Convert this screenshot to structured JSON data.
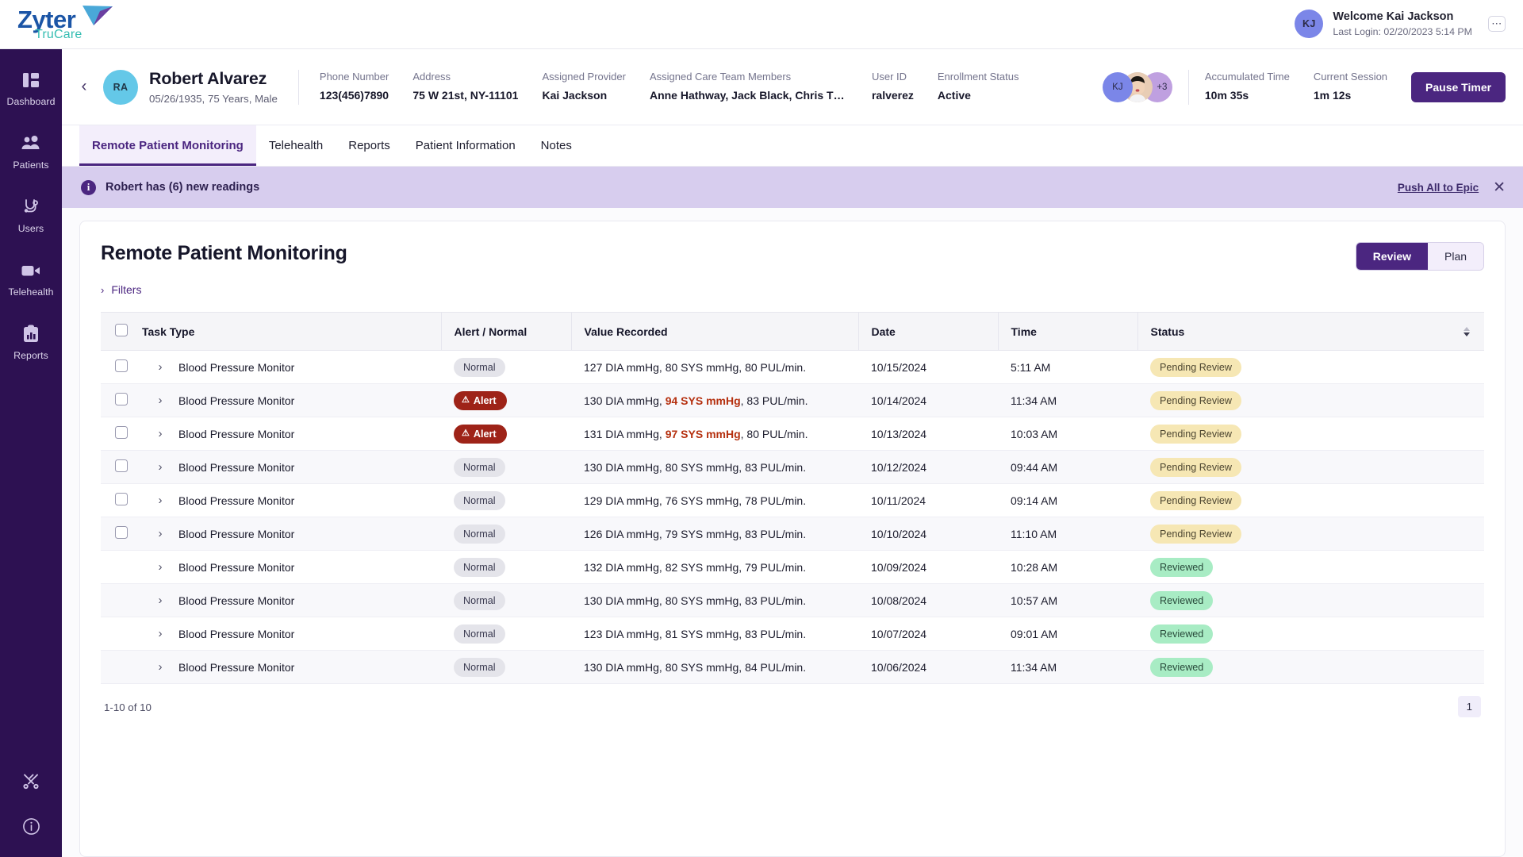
{
  "brand": {
    "name_main": "Zyter",
    "name_sub": "TruCare"
  },
  "topbar": {
    "avatar_initials": "KJ",
    "welcome": "Welcome Kai Jackson",
    "last_login": "Last Login: 02/20/2023 5:14 PM",
    "kebab_label": "⋯"
  },
  "sidebar": {
    "items": [
      {
        "label": "Dashboard",
        "icon": "dashboard-icon"
      },
      {
        "label": "Patients",
        "icon": "patients-icon"
      },
      {
        "label": "Users",
        "icon": "stethoscope-icon"
      },
      {
        "label": "Telehealth",
        "icon": "video-camera-icon"
      },
      {
        "label": "Reports",
        "icon": "clipboard-chart-icon"
      }
    ],
    "bottom": [
      {
        "icon": "tools-icon"
      },
      {
        "icon": "info-circle-icon"
      }
    ]
  },
  "patient": {
    "back_icon": "‹",
    "avatar_initials": "RA",
    "name": "Robert Alvarez",
    "subtitle": "05/26/1935, 75 Years, Male",
    "fields": [
      {
        "label": "Phone Number",
        "value": "123(456)7890"
      },
      {
        "label": "Address",
        "value": "75 W 21st, NY-11101"
      },
      {
        "label": "Assigned Provider",
        "value": "Kai Jackson"
      },
      {
        "label": "Assigned Care Team Members",
        "value": "Anne Hathway, Jack Black, Chris Th..."
      },
      {
        "label": "User ID",
        "value": "ralverez"
      },
      {
        "label": "Enrollment Status",
        "value": "Active"
      }
    ],
    "care_avatars": {
      "first": "KJ",
      "overflow": "+3"
    },
    "timers": [
      {
        "label": "Accumulated Time",
        "value": "10m 35s"
      },
      {
        "label": "Current Session",
        "value": "1m 12s"
      }
    ],
    "pause_timer": "Pause Timer"
  },
  "tabs": [
    {
      "label": "Remote Patient Monitoring",
      "active": true
    },
    {
      "label": "Telehealth",
      "active": false
    },
    {
      "label": "Reports",
      "active": false
    },
    {
      "label": "Patient Information",
      "active": false
    },
    {
      "label": "Notes",
      "active": false
    }
  ],
  "banner": {
    "icon": "info-icon",
    "text": "Robert has (6) new readings",
    "action": "Push All to Epic",
    "close_icon": "✕"
  },
  "panel": {
    "title": "Remote Patient Monitoring",
    "filters_label": "Filters",
    "filters_chevron": "›",
    "segment": {
      "primary": "Review",
      "secondary": "Plan"
    }
  },
  "table": {
    "columns": [
      "Task Type",
      "Alert / Normal",
      "Value Recorded",
      "Date",
      "Time",
      "Status"
    ],
    "rows": [
      {
        "checkbox": true,
        "task": "Blood Pressure Monitor",
        "alert": "Normal",
        "alert_type": "normal",
        "value_pre": "127 DIA mmHg, ",
        "value_hi": "80 SYS mmHg",
        "value_post": ", 80 PUL/min.",
        "highlight": false,
        "date": "10/15/2024",
        "time": "5:11 AM",
        "status": "Pending Review",
        "status_type": "pending"
      },
      {
        "checkbox": true,
        "task": "Blood Pressure Monitor",
        "alert": "Alert",
        "alert_type": "alert",
        "value_pre": "130 DIA mmHg, ",
        "value_hi": "94 SYS mmHg",
        "value_post": ", 83 PUL/min.",
        "highlight": true,
        "date": "10/14/2024",
        "time": "11:34 AM",
        "status": "Pending Review",
        "status_type": "pending"
      },
      {
        "checkbox": true,
        "task": "Blood Pressure Monitor",
        "alert": "Alert",
        "alert_type": "alert",
        "value_pre": "131 DIA mmHg, ",
        "value_hi": "97 SYS mmHg",
        "value_post": ", 80 PUL/min.",
        "highlight": true,
        "date": "10/13/2024",
        "time": "10:03 AM",
        "status": "Pending Review",
        "status_type": "pending"
      },
      {
        "checkbox": true,
        "task": "Blood Pressure Monitor",
        "alert": "Normal",
        "alert_type": "normal",
        "value_pre": "130 DIA mmHg, ",
        "value_hi": "80 SYS mmHg",
        "value_post": ", 83 PUL/min.",
        "highlight": false,
        "date": "10/12/2024",
        "time": "09:44 AM",
        "status": "Pending Review",
        "status_type": "pending"
      },
      {
        "checkbox": true,
        "task": "Blood Pressure Monitor",
        "alert": "Normal",
        "alert_type": "normal",
        "value_pre": "129 DIA mmHg, ",
        "value_hi": "76 SYS mmHg",
        "value_post": ", 78 PUL/min.",
        "highlight": false,
        "date": "10/11/2024",
        "time": "09:14 AM",
        "status": "Pending Review",
        "status_type": "pending"
      },
      {
        "checkbox": true,
        "task": "Blood Pressure Monitor",
        "alert": "Normal",
        "alert_type": "normal",
        "value_pre": "126 DIA mmHg, ",
        "value_hi": "79 SYS mmHg",
        "value_post": ", 83 PUL/min.",
        "highlight": false,
        "date": "10/10/2024",
        "time": "11:10 AM",
        "status": "Pending Review",
        "status_type": "pending"
      },
      {
        "checkbox": false,
        "task": "Blood Pressure Monitor",
        "alert": "Normal",
        "alert_type": "normal",
        "value_pre": "132 DIA mmHg, ",
        "value_hi": "82 SYS mmHg",
        "value_post": ", 79 PUL/min.",
        "highlight": false,
        "date": "10/09/2024",
        "time": "10:28 AM",
        "status": "Reviewed",
        "status_type": "reviewed"
      },
      {
        "checkbox": false,
        "task": "Blood Pressure Monitor",
        "alert": "Normal",
        "alert_type": "normal",
        "value_pre": "130 DIA mmHg, ",
        "value_hi": "80 SYS mmHg",
        "value_post": ", 83 PUL/min.",
        "highlight": false,
        "date": "10/08/2024",
        "time": "10:57 AM",
        "status": "Reviewed",
        "status_type": "reviewed"
      },
      {
        "checkbox": false,
        "task": "Blood Pressure Monitor",
        "alert": "Normal",
        "alert_type": "normal",
        "value_pre": "123 DIA mmHg, ",
        "value_hi": "81 SYS mmHg",
        "value_post": ", 83 PUL/min.",
        "highlight": false,
        "date": "10/07/2024",
        "time": "09:01 AM",
        "status": "Reviewed",
        "status_type": "reviewed"
      },
      {
        "checkbox": false,
        "task": "Blood Pressure Monitor",
        "alert": "Normal",
        "alert_type": "normal",
        "value_pre": "130 DIA mmHg, ",
        "value_hi": "80 SYS mmHg",
        "value_post": ", 84 PUL/min.",
        "highlight": false,
        "date": "10/06/2024",
        "time": "11:34 AM",
        "status": "Reviewed",
        "status_type": "reviewed"
      }
    ]
  },
  "pagination": {
    "info": "1-10 of 10",
    "current_page": "1"
  },
  "colors": {
    "sidebar": "#2d1152",
    "accent": "#4b2680",
    "banner": "#d7cdee",
    "alert_red": "#9e2318",
    "value_highlight": "#b5300f",
    "pending": "#f6e7b4",
    "reviewed": "#a8ecc4",
    "patient_avatar": "#64c8e8"
  }
}
